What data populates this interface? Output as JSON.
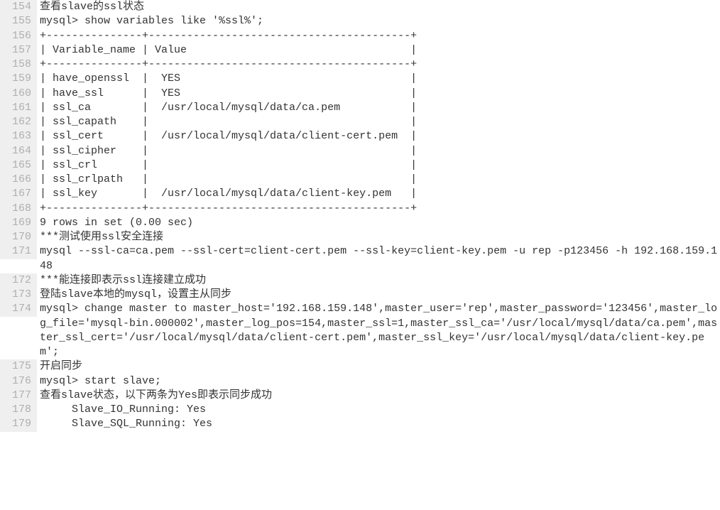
{
  "lines": [
    {
      "num": "154",
      "text": "查看slave的ssl状态"
    },
    {
      "num": "155",
      "text": "mysql> show variables like '%ssl%';"
    },
    {
      "num": "156",
      "text": "+---------------+-----------------------------------------+"
    },
    {
      "num": "157",
      "text": "| Variable_name | Value                                   |"
    },
    {
      "num": "158",
      "text": "+---------------+-----------------------------------------+"
    },
    {
      "num": "159",
      "text": "| have_openssl  |  YES                                    |"
    },
    {
      "num": "160",
      "text": "| have_ssl      |  YES                                    |"
    },
    {
      "num": "161",
      "text": "| ssl_ca        |  /usr/local/mysql/data/ca.pem           |"
    },
    {
      "num": "162",
      "text": "| ssl_capath    |                                         |"
    },
    {
      "num": "163",
      "text": "| ssl_cert      |  /usr/local/mysql/data/client-cert.pem  |"
    },
    {
      "num": "164",
      "text": "| ssl_cipher    |                                         |"
    },
    {
      "num": "165",
      "text": "| ssl_crl       |                                         |"
    },
    {
      "num": "166",
      "text": "| ssl_crlpath   |                                         |"
    },
    {
      "num": "167",
      "text": "| ssl_key       |  /usr/local/mysql/data/client-key.pem   |"
    },
    {
      "num": "168",
      "text": "+---------------+-----------------------------------------+"
    },
    {
      "num": "169",
      "text": "9 rows in set (0.00 sec)"
    },
    {
      "num": "170",
      "text": "***测试使用ssl安全连接"
    },
    {
      "num": "171",
      "text": "mysql --ssl-ca=ca.pem --ssl-cert=client-cert.pem --ssl-key=client-key.pem -u rep -p123456 -h 192.168.159.148"
    },
    {
      "num": "172",
      "text": "***能连接即表示ssl连接建立成功"
    },
    {
      "num": "173",
      "text": "登陆slave本地的mysql，设置主从同步"
    },
    {
      "num": "174",
      "text": "mysql> change master to master_host='192.168.159.148',master_user='rep',master_password='123456',master_log_file='mysql-bin.000002',master_log_pos=154,master_ssl=1,master_ssl_ca='/usr/local/mysql/data/ca.pem',master_ssl_cert='/usr/local/mysql/data/client-cert.pem',master_ssl_key='/usr/local/mysql/data/client-key.pem';"
    },
    {
      "num": "175",
      "text": "开启同步"
    },
    {
      "num": "176",
      "text": "mysql> start slave;"
    },
    {
      "num": "177",
      "text": "查看slave状态，以下两条为Yes即表示同步成功"
    },
    {
      "num": "178",
      "text": "     Slave_IO_Running: Yes"
    },
    {
      "num": "179",
      "text": "     Slave_SQL_Running: Yes"
    }
  ]
}
